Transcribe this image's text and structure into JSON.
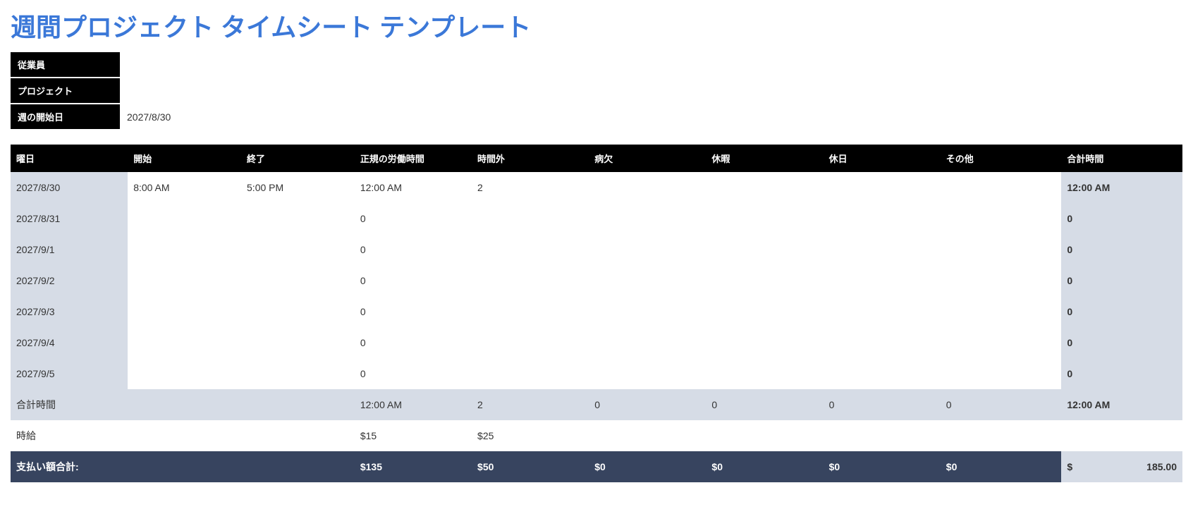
{
  "title": "週間プロジェクト タイムシート テンプレート",
  "meta": {
    "employee_label": "従業員",
    "employee_value": "",
    "project_label": "プロジェクト",
    "project_value": "",
    "week_start_label": "週の開始日",
    "week_start_value": "2027/8/30"
  },
  "headers": {
    "day": "曜日",
    "start": "開始",
    "end": "終了",
    "regular": "正規の労働時間",
    "overtime": "時間外",
    "sick": "病欠",
    "vacation": "休暇",
    "holiday": "休日",
    "other": "その他",
    "total": "合計時間"
  },
  "rows": [
    {
      "day": "2027/8/30",
      "start": "8:00 AM",
      "end": "5:00 PM",
      "regular": "12:00 AM",
      "overtime": "2",
      "sick": "",
      "vacation": "",
      "holiday": "",
      "other": "",
      "total": "12:00 AM"
    },
    {
      "day": "2027/8/31",
      "start": "",
      "end": "",
      "regular": "0",
      "overtime": "",
      "sick": "",
      "vacation": "",
      "holiday": "",
      "other": "",
      "total": "0"
    },
    {
      "day": "2027/9/1",
      "start": "",
      "end": "",
      "regular": "0",
      "overtime": "",
      "sick": "",
      "vacation": "",
      "holiday": "",
      "other": "",
      "total": "0"
    },
    {
      "day": "2027/9/2",
      "start": "",
      "end": "",
      "regular": "0",
      "overtime": "",
      "sick": "",
      "vacation": "",
      "holiday": "",
      "other": "",
      "total": "0"
    },
    {
      "day": "2027/9/3",
      "start": "",
      "end": "",
      "regular": "0",
      "overtime": "",
      "sick": "",
      "vacation": "",
      "holiday": "",
      "other": "",
      "total": "0"
    },
    {
      "day": "2027/9/4",
      "start": "",
      "end": "",
      "regular": "0",
      "overtime": "",
      "sick": "",
      "vacation": "",
      "holiday": "",
      "other": "",
      "total": "0"
    },
    {
      "day": "2027/9/5",
      "start": "",
      "end": "",
      "regular": "0",
      "overtime": "",
      "sick": "",
      "vacation": "",
      "holiday": "",
      "other": "",
      "total": "0"
    }
  ],
  "totals": {
    "label": "合計時間",
    "regular": "12:00 AM",
    "overtime": "2",
    "sick": "0",
    "vacation": "0",
    "holiday": "0",
    "other": "0",
    "total": "12:00 AM"
  },
  "rate": {
    "label": "時給",
    "regular": "$15",
    "overtime": "$25",
    "sick": "",
    "vacation": "",
    "holiday": "",
    "other": ""
  },
  "pay": {
    "label": "支払い額合計:",
    "regular": "$135",
    "overtime": "$50",
    "sick": "$0",
    "vacation": "$0",
    "holiday": "$0",
    "other": "$0",
    "currency": "$",
    "grand": "185.00"
  }
}
